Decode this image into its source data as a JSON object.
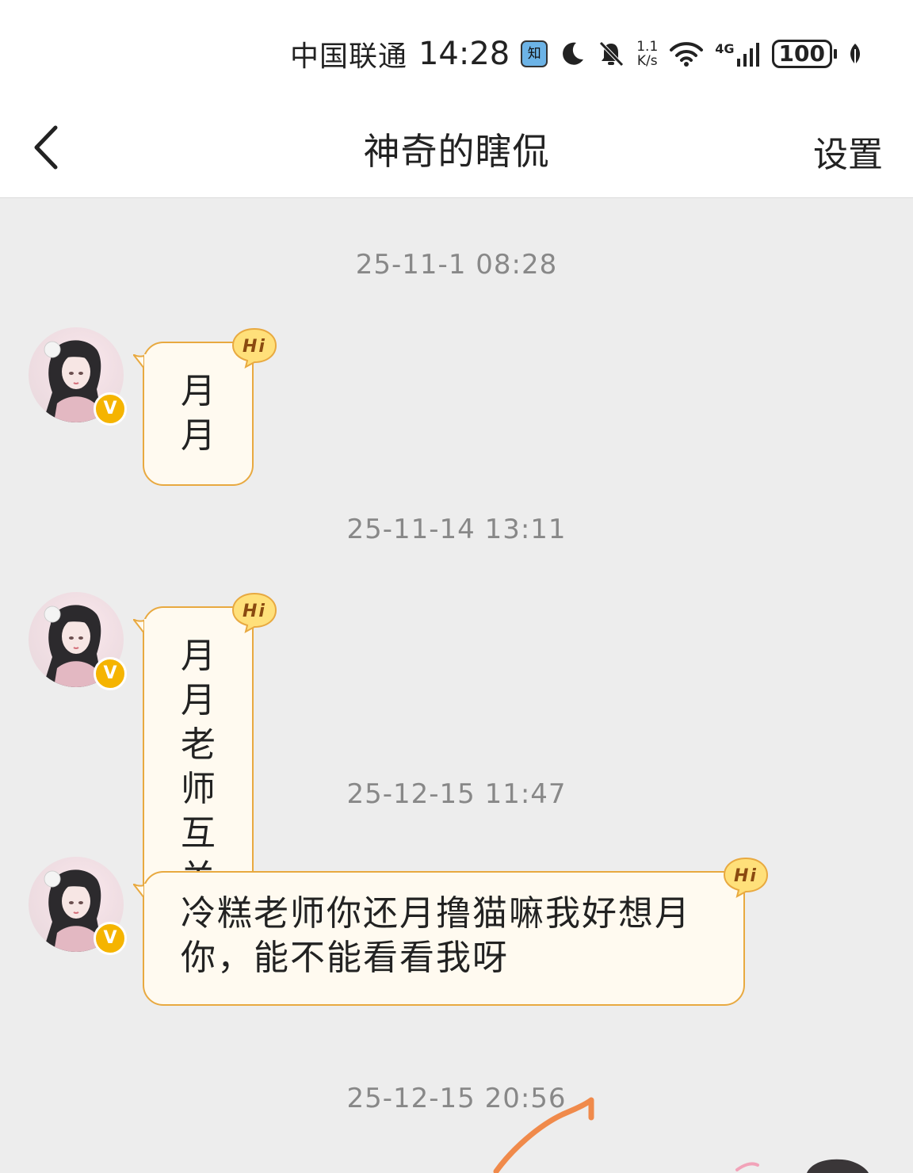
{
  "status_bar": {
    "carrier": "中国联通",
    "time": "14:28",
    "app_badge": "知",
    "speed_value": "1.1",
    "speed_unit": "K/s",
    "network": "4G",
    "battery": "100"
  },
  "header": {
    "title": "神奇的瞎侃",
    "settings_label": "设置"
  },
  "messages": [
    {
      "timestamp": "25-11-1 08:28",
      "text": "月月",
      "badge": "Hi"
    },
    {
      "timestamp": "25-11-14 13:11",
      "text": "月月老师互关嘛",
      "badge": "Hi"
    },
    {
      "timestamp": "25-12-15 11:47",
      "text": "冷糕老师你还月撸猫嘛我好想月你，能不能看看我呀",
      "badge": "Hi"
    }
  ],
  "last_timestamp": "25-12-15 20:56",
  "colors": {
    "background": "#ededed",
    "bubble_fill": "#fffaf0",
    "bubble_border": "#e8a940",
    "badge_yellow": "#f5b400",
    "annotation_stroke": "#f08a4b"
  }
}
